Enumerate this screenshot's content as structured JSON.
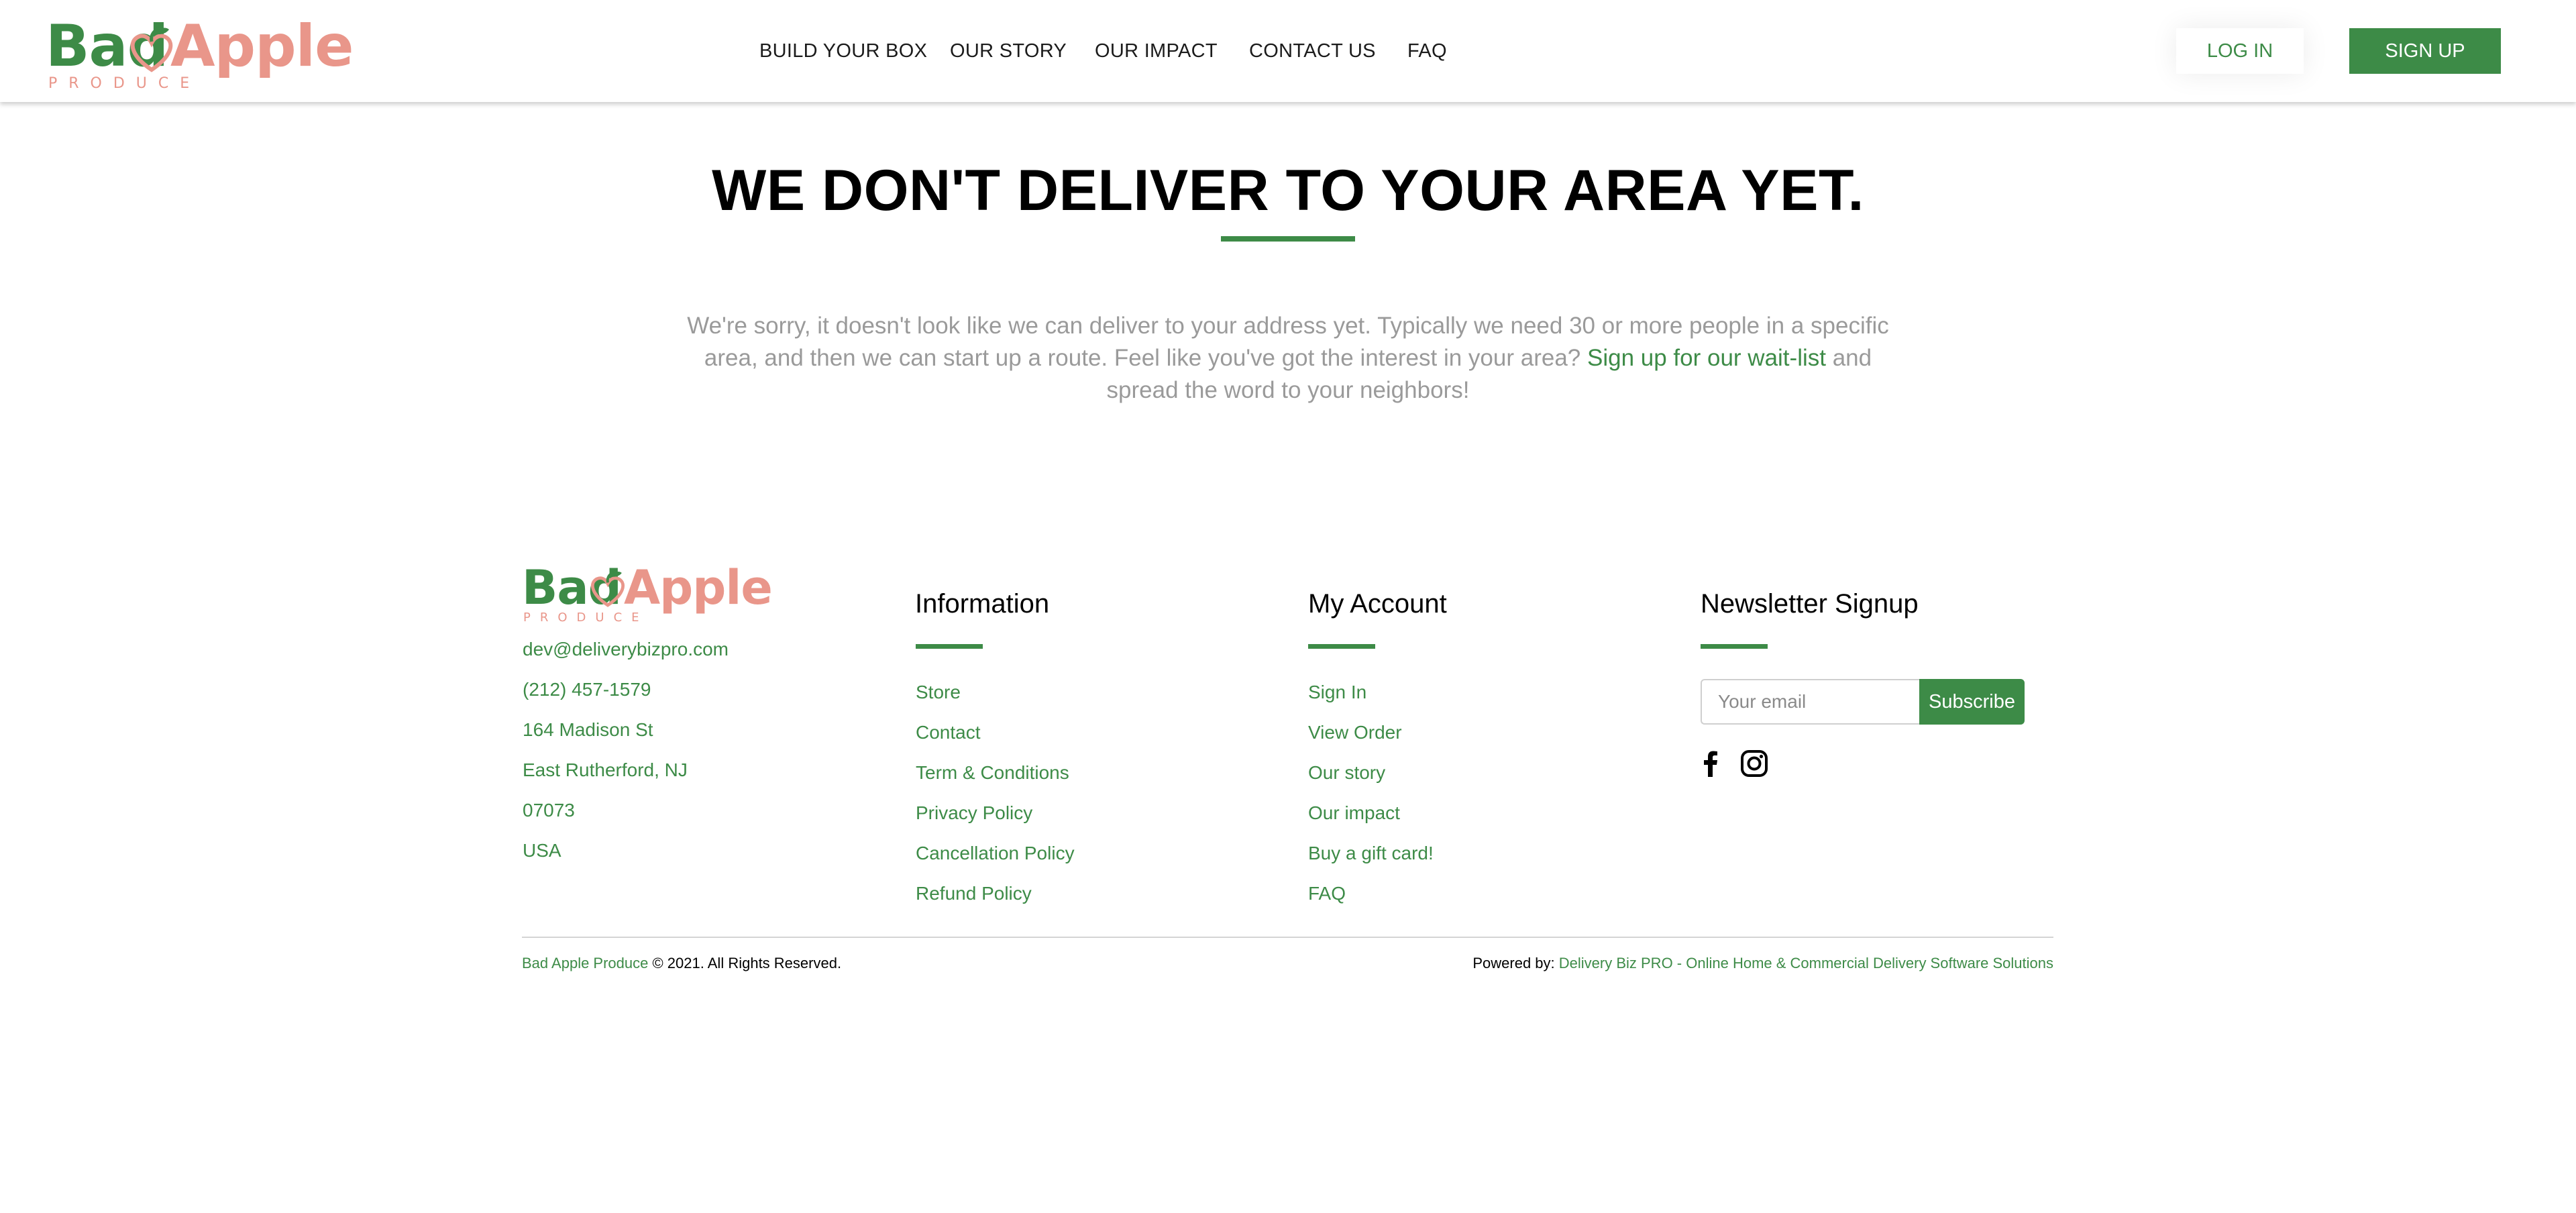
{
  "colors": {
    "brand_green": "#3d8b47",
    "brand_peach": "#e9968a",
    "muted_text": "#9a9a9a"
  },
  "brand": {
    "name_part1": "Bad",
    "name_part2": "Apple",
    "tagline": "PRODUCE",
    "icon": "apple-heart-icon"
  },
  "nav": {
    "items": [
      "BUILD YOUR BOX",
      "OUR STORY",
      "OUR IMPACT",
      "CONTACT US",
      "FAQ"
    ],
    "login_label": "LOG IN",
    "signup_label": "SIGN UP"
  },
  "main": {
    "title": "WE DON'T DELIVER TO YOUR AREA YET.",
    "message_before": "We're sorry, it doesn't look like we can deliver to your address yet.  Typically we need 30 or more people in a specific area, and then we can start up a route.  Feel like you've got the interest in your area?  ",
    "message_link": "Sign up for our wait-list",
    "message_after": " and spread the word to your neighbors!"
  },
  "footer": {
    "contact": {
      "email": "dev@deliverybizpro.com",
      "phone": "(212) 457-1579",
      "street": "164 Madison St",
      "city_state": "East Rutherford, NJ",
      "zip": "07073",
      "country": "USA"
    },
    "information": {
      "heading": "Information",
      "links": [
        "Store",
        "Contact",
        "Term & Conditions",
        "Privacy Policy",
        "Cancellation Policy",
        "Refund Policy"
      ]
    },
    "account": {
      "heading": "My Account",
      "links": [
        "Sign In",
        "View Order",
        "Our story",
        "Our impact",
        "Buy a gift card!",
        "FAQ"
      ]
    },
    "newsletter": {
      "heading": "Newsletter Signup",
      "placeholder": "Your email",
      "button_label": "Subscribe",
      "social_icons": [
        "facebook-icon",
        "instagram-icon"
      ]
    },
    "copyright_brand": "Bad Apple Produce",
    "copyright_text": " © 2021. All Rights Reserved.",
    "powered_label": "Powered by: ",
    "powered_link": "Delivery Biz PRO - Online Home & Commercial Delivery Software Solutions"
  }
}
